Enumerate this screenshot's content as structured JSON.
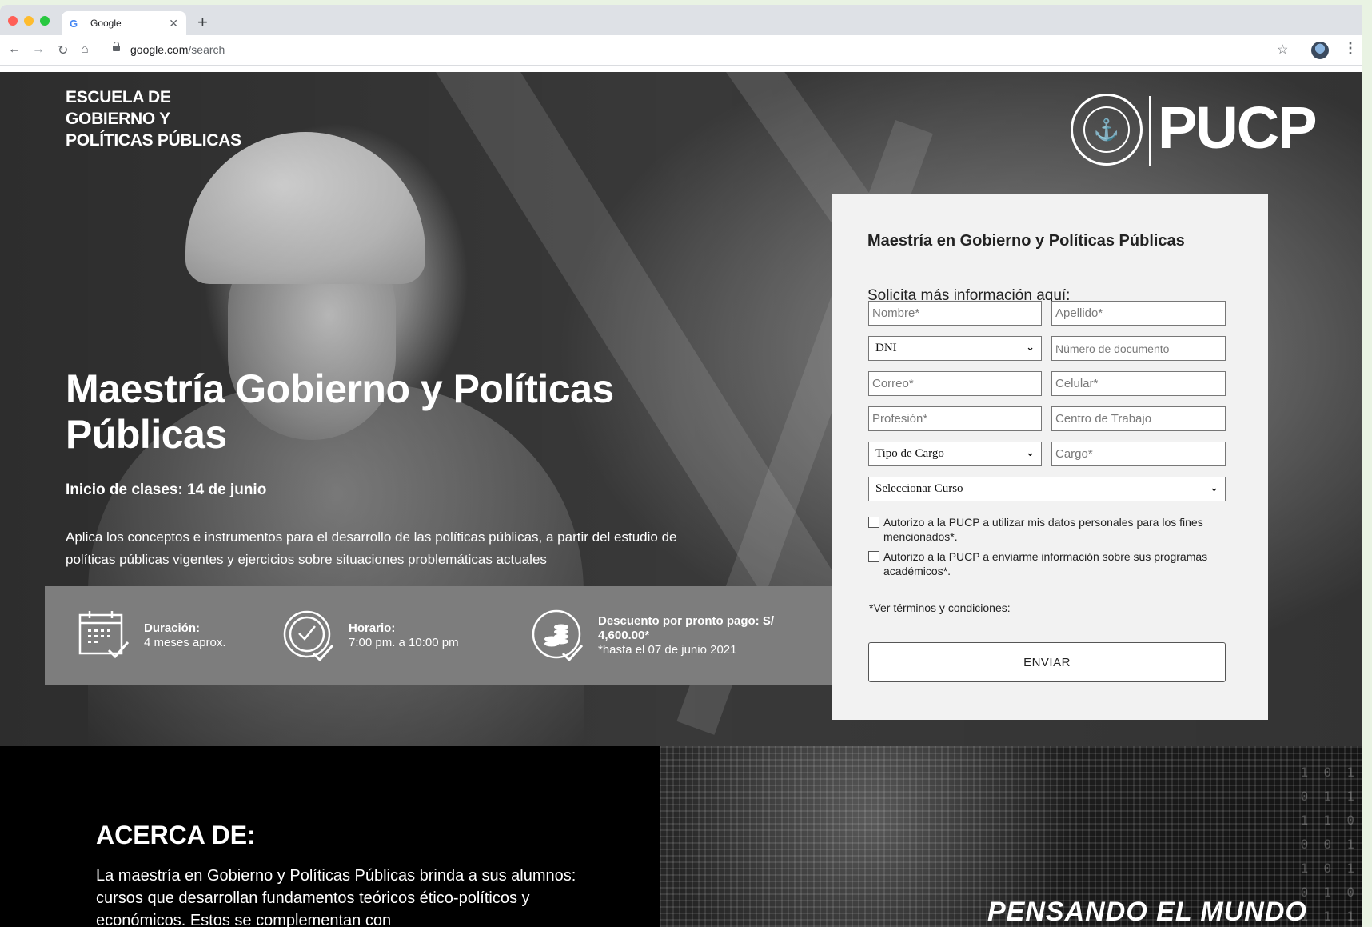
{
  "browser": {
    "tab_title": "Google",
    "tab_favicon": "G",
    "url_host": "google.com",
    "url_path": "/search"
  },
  "hero": {
    "school_line1": "ESCUELA DE",
    "school_line2": "GOBIERNO Y",
    "school_line3": "POLÍTICAS PÚBLICAS",
    "logo_text": "PUCP",
    "title": "Maestría Gobierno y Políticas Públicas",
    "start": "Inicio de clases: 14 de junio",
    "description": "Aplica los conceptos e instrumentos para el desarrollo de las políticas públicas, a partir del estudio de políticas públicas vigentes y ejercicios sobre situaciones problemáticas actuales",
    "info": [
      {
        "label": "Duración:",
        "value": "4 meses aprox.",
        "icon": "calendar-icon"
      },
      {
        "label": "Horario:",
        "value": "7:00 pm. a 10:00 pm",
        "icon": "clock-icon"
      },
      {
        "label": "Descuento por pronto pago: S/ 4,600.00*",
        "value": "*hasta el 07 de junio 2021",
        "icon": "coins-icon"
      }
    ]
  },
  "form": {
    "title": "Maestría en Gobierno y Políticas Públicas",
    "subtitle": "Solicita más información aquí:",
    "nombre_placeholder": "Nombre*",
    "apellido_placeholder": "Apellido*",
    "doc_type_selected": "DNI",
    "doc_number_placeholder": "Número de documento",
    "correo_placeholder": "Correo*",
    "celular_placeholder": "Celular*",
    "profesion_placeholder": "Profesión*",
    "centro_placeholder": "Centro de Trabajo",
    "tipo_cargo_selected": "Tipo de Cargo",
    "cargo_placeholder": "Cargo*",
    "curso_selected": "Seleccionar Curso",
    "consent1": "Autorizo a la PUCP a utilizar mis datos personales para los fines mencionados*.",
    "consent2": "Autorizo a la PUCP a enviarme información sobre sus programas académicos*.",
    "terms": "*Ver términos y condiciones:",
    "submit": "ENVIAR"
  },
  "about": {
    "heading": "ACERCA DE:",
    "text": "La maestría en Gobierno y Políticas Públicas brinda a sus alumnos: cursos que desarrollan fundamentos teóricos ético-políticos y económicos. Estos se complementan con"
  },
  "world": {
    "title": "PENSANDO EL MUNDO"
  }
}
